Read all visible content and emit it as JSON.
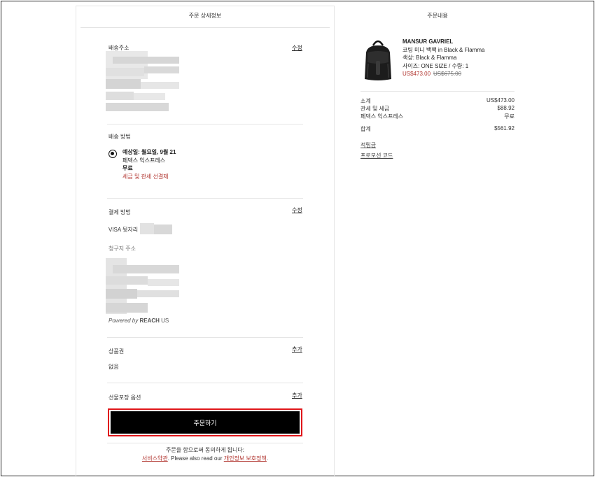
{
  "left": {
    "title": "주문 상세정보",
    "shipping_address": {
      "label": "배송주소",
      "edit": "수정"
    },
    "shipping_method": {
      "label": "배송 방법",
      "eta": "예상일: 월요일, 9월 21",
      "carrier": "페덱스 익스프레스",
      "price": "무료",
      "duty_note": "세금 및 관세 선결제"
    },
    "payment": {
      "label": "결제 방법",
      "edit": "수정",
      "card_prefix": "VISA 뒷자리",
      "billing_label": "청구지 주소",
      "powered_prefix": "Powered by ",
      "powered_brand": "REACH",
      "powered_suffix": " US"
    },
    "gift_card": {
      "label": "상품권",
      "add": "추가",
      "value": "없음"
    },
    "gift_wrap": {
      "label": "선물포장 옵션",
      "add": "추가"
    },
    "order_button": "주문하기",
    "agree_line1": "주문을 함으로써 동의하게 됩니다:",
    "terms_link": "서비스약관",
    "agree_mid": ". Please also read our ",
    "privacy_link": "개인정보 보호정책",
    "agree_end": "."
  },
  "right": {
    "title": "주문내용",
    "product": {
      "brand": "MANSUR GAVRIEL",
      "name": "코팅 미니 백팩 in Black & Flamma",
      "color": "색상: Black & Flamma",
      "size_qty": "사이즈: ONE SIZE / 수량: 1",
      "price": "US$473.00",
      "original_price": "US$675.00"
    },
    "summary": {
      "subtotal_label": "소계",
      "subtotal": "US$473.00",
      "duties_label": "관세 및 세금",
      "duties": "$88.92",
      "shipping_label": "페덱스 익스프레스",
      "shipping": "무료",
      "total_label": "합계",
      "total": "$561.92"
    },
    "credit_link": "적립금",
    "promo_link": "프로모션 코드"
  },
  "colors": {
    "accent_red": "#b0322c",
    "button_border": "#e0161a",
    "button_bg": "#000000"
  }
}
